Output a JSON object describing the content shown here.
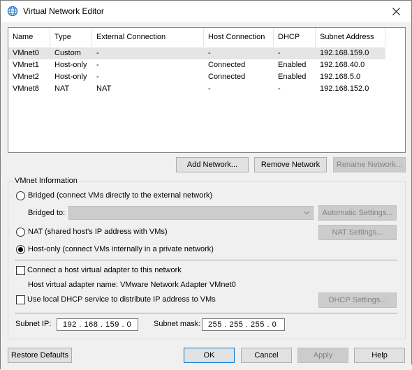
{
  "window": {
    "title": "Virtual Network Editor"
  },
  "table": {
    "columns": [
      "Name",
      "Type",
      "External Connection",
      "Host Connection",
      "DHCP",
      "Subnet Address"
    ],
    "rows": [
      [
        "VMnet0",
        "Custom",
        "-",
        "-",
        "-",
        "192.168.159.0"
      ],
      [
        "VMnet1",
        "Host-only",
        "-",
        "Connected",
        "Enabled",
        "192.168.40.0"
      ],
      [
        "VMnet2",
        "Host-only",
        "-",
        "Connected",
        "Enabled",
        "192.168.5.0"
      ],
      [
        "VMnet8",
        "NAT",
        "NAT",
        "-",
        "-",
        "192.168.152.0"
      ]
    ],
    "selected_row": 0
  },
  "network_buttons": {
    "add": "Add Network...",
    "remove": "Remove Network",
    "rename": "Rename Network..."
  },
  "vmnet_info": {
    "group_label": "VMnet Information",
    "bridged_label": "Bridged (connect VMs directly to the external network)",
    "bridged_to_label": "Bridged to:",
    "bridged_to_value": "",
    "automatic_settings": "Automatic Settings...",
    "nat_label": "NAT (shared host's IP address with VMs)",
    "nat_settings": "NAT Settings...",
    "hostonly_label": "Host-only (connect VMs internally in a private network)",
    "selected_mode": "host-only",
    "connect_adapter_label": "Connect a host virtual adapter to this network",
    "connect_adapter_checked": false,
    "adapter_name_label": "Host virtual adapter name: VMware Network Adapter VMnet0",
    "dhcp_label": "Use local DHCP service to distribute IP address to VMs",
    "dhcp_checked": false,
    "dhcp_settings": "DHCP Settings...",
    "subnet_ip_label": "Subnet IP:",
    "subnet_ip": "192 . 168 . 159 .  0",
    "subnet_mask_label": "Subnet mask:",
    "subnet_mask": "255 . 255 . 255 .  0"
  },
  "footer": {
    "restore": "Restore Defaults",
    "ok": "OK",
    "cancel": "Cancel",
    "apply": "Apply",
    "help": "Help"
  },
  "colors": {
    "accent": "#0078d7",
    "selected_row": "#e5e5e5",
    "disabled_text": "#838383"
  },
  "icons": [
    "globe-network-icon",
    "close-icon",
    "chevron-down-icon"
  ]
}
